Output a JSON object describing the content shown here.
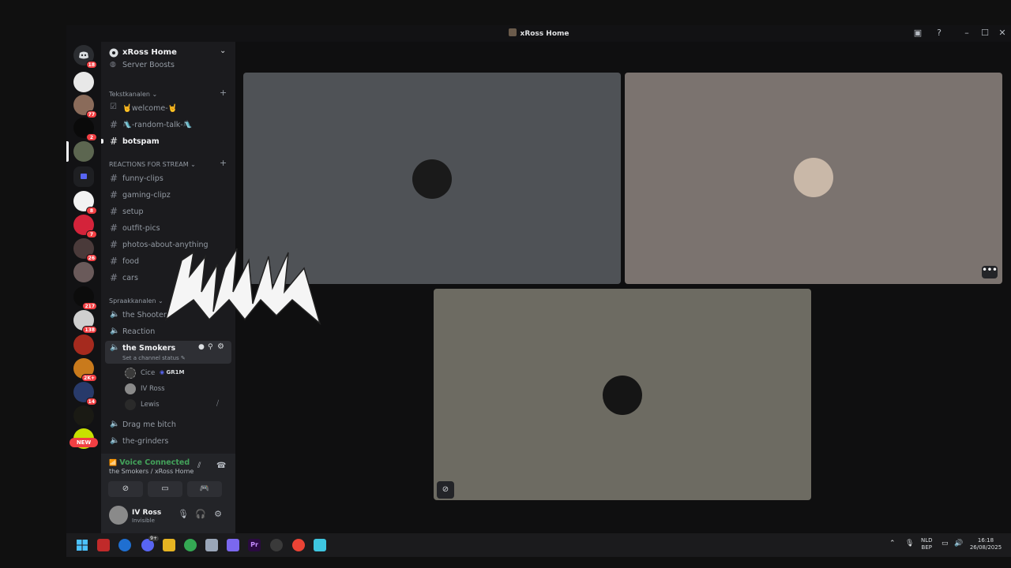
{
  "window": {
    "title": "xRoss Home"
  },
  "titlebar_icons": [
    "inbox-icon",
    "help-icon",
    "minimize-icon",
    "maximize-icon",
    "close-icon"
  ],
  "server_badges": {
    "dm": "18",
    "s2": "77",
    "s3": "2",
    "s6": "8",
    "s7": "7",
    "s8": "26",
    "s10": "217",
    "s11": "138",
    "s13": "2K+",
    "s14": "14",
    "new": "NEW"
  },
  "guild": {
    "name": "xRoss Home",
    "boosts": "Server Boosts"
  },
  "categories": {
    "text": "Tekstkanalen",
    "stream": "REACTIONS FOR STREAM",
    "voice": "Spraakkanalen"
  },
  "text_channels": [
    "🤘welcome-🤘",
    "🛝-random-talk-🛝",
    "botspam"
  ],
  "stream_channels": [
    "funny-clips",
    "gaming-clipz",
    "setup",
    "outfit-pics",
    "photos-about-anything",
    "food",
    "cars"
  ],
  "voice_channels": {
    "shooters": "the Shooters",
    "reaction": "Reaction",
    "smokers": "the Smokers",
    "smokers_status": "Set a channel status",
    "drag": "Drag me bitch",
    "grinders": "the-grinders"
  },
  "members": [
    {
      "name": "Cice",
      "tag": "GR1M"
    },
    {
      "name": "IV Ross"
    },
    {
      "name": "Lewis"
    }
  ],
  "voice_panel": {
    "status": "Voice Connected",
    "location": "the Smokers / xRoss Home"
  },
  "user": {
    "name": "IV Ross",
    "status": "Invisible"
  },
  "colors": {
    "tile1": "#4f5256",
    "tile2": "#7b736f",
    "tile3": "#6d6b62",
    "voice_green": "#43a25a",
    "badge_red": "#f23f43",
    "accent": "#5865f2"
  },
  "tiles": {
    "more_label": "•••"
  },
  "taskbar": {
    "lang": "NLD",
    "layout": "BEP",
    "time": "16:18",
    "date": "26/08/2025",
    "teams_badge": "9+"
  }
}
